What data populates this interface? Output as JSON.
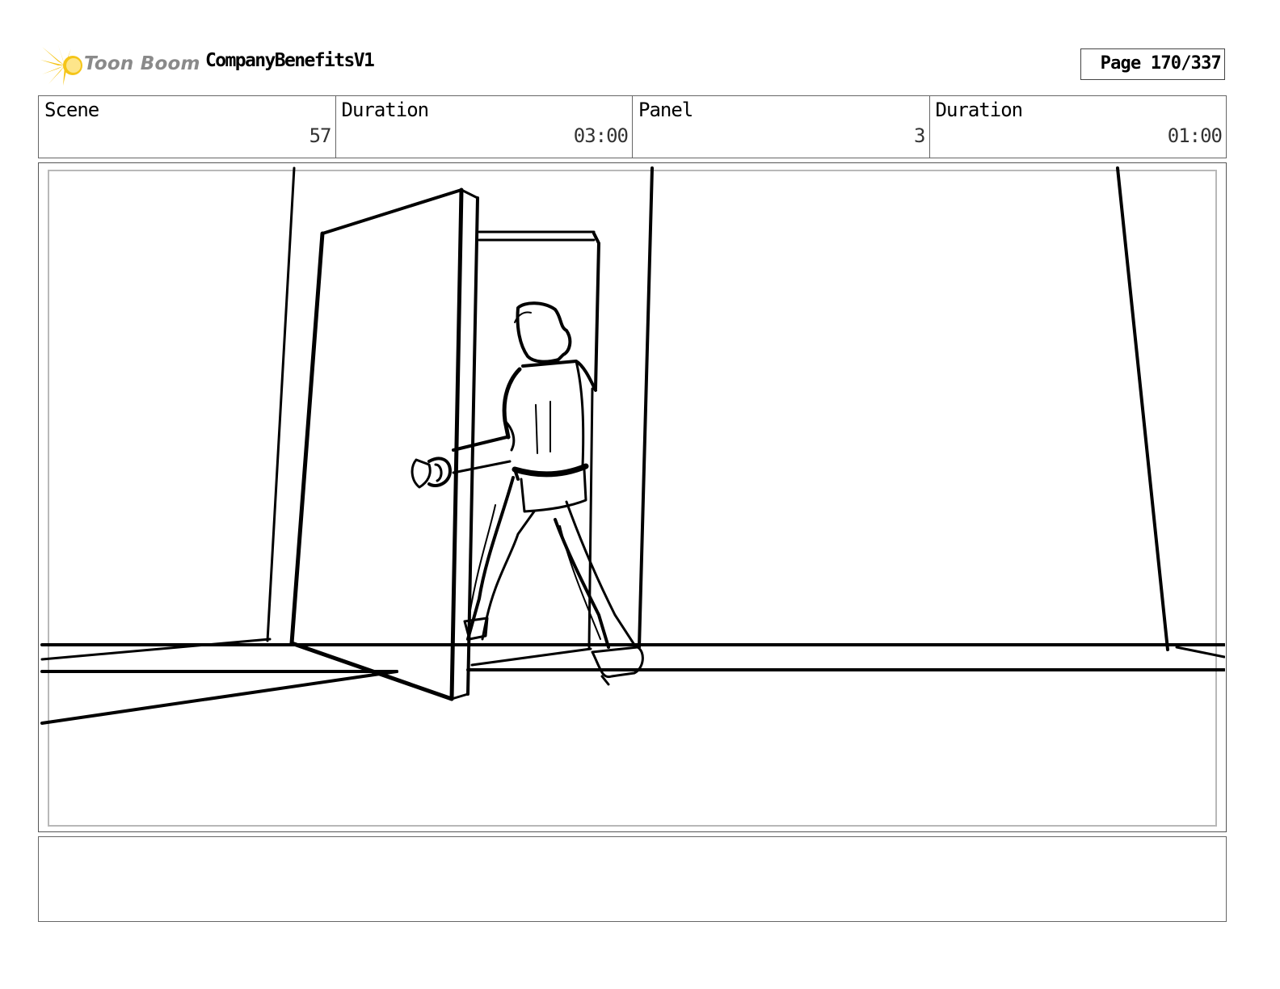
{
  "header": {
    "logo_text": "Toon Boom",
    "project_title": "CompanyBenefitsV1",
    "page_indicator": "Page 170/337"
  },
  "info": {
    "scene_label": "Scene",
    "scene_value": "57",
    "scene_duration_label": "Duration",
    "scene_duration_value": "03:00",
    "panel_label": "Panel",
    "panel_value": "3",
    "panel_duration_label": "Duration",
    "panel_duration_value": "01:00"
  },
  "colors": {
    "logo_sun": "#f5c518",
    "logo_text": "#8a8a8a",
    "border": "#666666"
  },
  "panel": {
    "image": "sketch of a person walking through an open door"
  },
  "notes": {
    "text": ""
  }
}
